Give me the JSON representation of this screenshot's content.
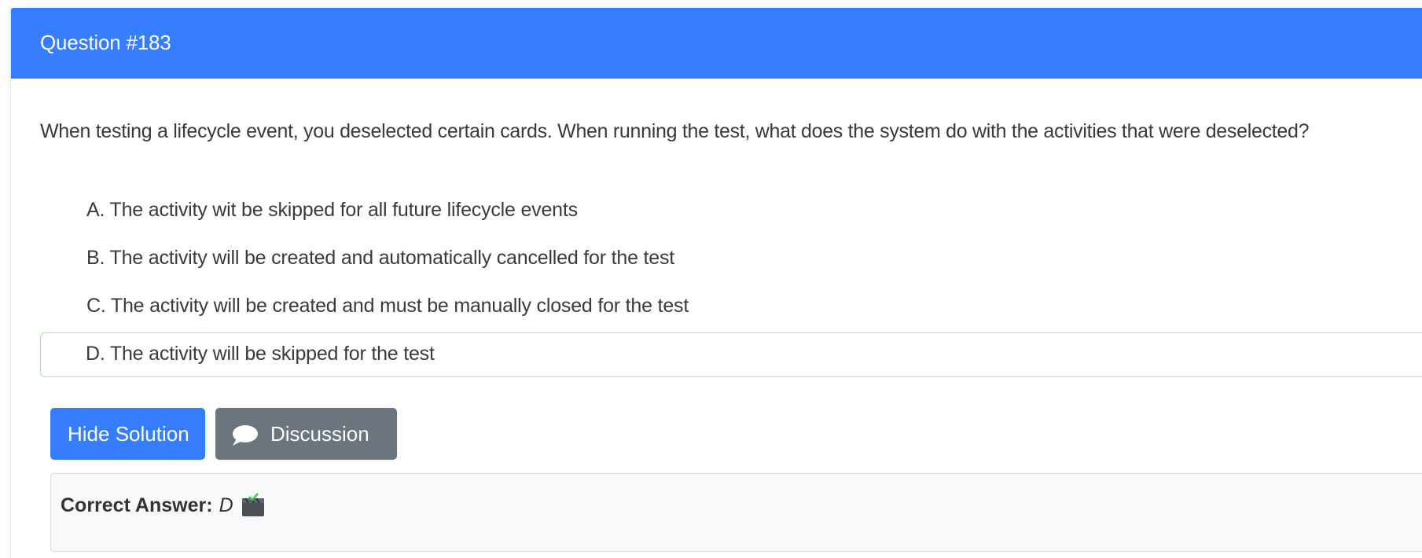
{
  "header": {
    "title": "Question #183"
  },
  "question": {
    "text": "When testing a lifecycle event, you deselected certain cards. When running the test, what does the system do with the activities that were deselected?"
  },
  "choices": [
    {
      "text": "A. The activity wit be skipped for all future lifecycle events",
      "correct": false
    },
    {
      "text": "B. The activity will be created and automatically cancelled for the test",
      "correct": false
    },
    {
      "text": "C. The activity will be created and must be manually closed for the test",
      "correct": false
    },
    {
      "text": "D. The activity will be skipped for the test",
      "correct": true
    }
  ],
  "actions": {
    "hide_solution_label": "Hide Solution",
    "discussion_label": "Discussion",
    "discussion_icon": "comment-icon"
  },
  "answer": {
    "label": "Correct Answer:",
    "value": "D",
    "icon": "clapperboard-check-icon"
  },
  "colors": {
    "primary": "#377dff",
    "secondary": "#6c757d",
    "correct_border": "#a6e6a0",
    "answer_bg": "#f8f9fa"
  }
}
